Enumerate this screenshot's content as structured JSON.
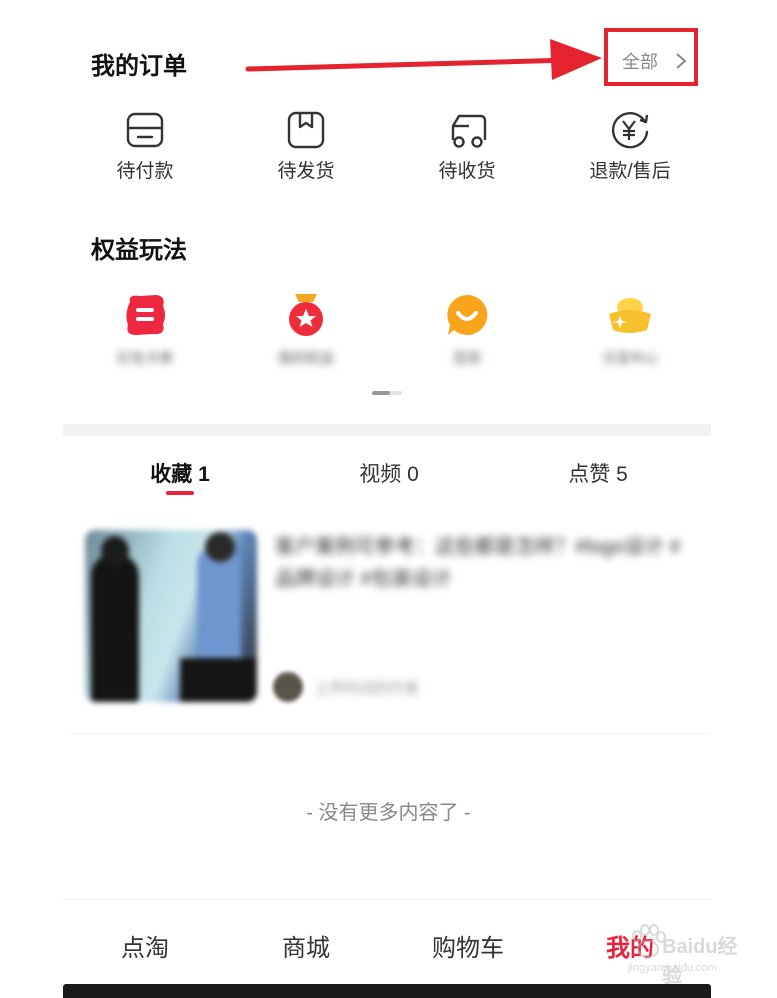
{
  "orders": {
    "title": "我的订单",
    "all_label": "全部",
    "items": [
      {
        "label": "待付款",
        "icon": "wallet-card-icon"
      },
      {
        "label": "待发货",
        "icon": "package-box-icon"
      },
      {
        "label": "待收货",
        "icon": "delivery-truck-icon"
      },
      {
        "label": "退款/售后",
        "icon": "yen-refund-icon"
      }
    ]
  },
  "perks": {
    "title": "权益玩法",
    "items": [
      {
        "label": "红包卡券",
        "icon": "red-coupon-icon"
      },
      {
        "label": "我的权益",
        "icon": "medal-icon"
      },
      {
        "label": "签到",
        "icon": "smile-bubble-icon"
      },
      {
        "label": "元宝中心",
        "icon": "gold-ingot-icon"
      }
    ]
  },
  "tabs": [
    {
      "label": "收藏 1",
      "active": true
    },
    {
      "label": "视频 0",
      "active": false
    },
    {
      "label": "点赞 5",
      "active": false
    }
  ],
  "feed_item": {
    "title": "客户案例可参考：这些都是怎样？#logo设计 #品牌设计 #包装设计",
    "author": "上传时间的作者"
  },
  "end_text": "- 没有更多内容了 -",
  "bottom_nav": [
    {
      "label": "点淘",
      "active": false
    },
    {
      "label": "商城",
      "active": false
    },
    {
      "label": "购物车",
      "active": false
    },
    {
      "label": "我的",
      "active": true
    }
  ],
  "watermark": {
    "text": "Baidu经验",
    "url_text": "jingyan.baidu.com"
  },
  "colors": {
    "accent": "#e8233c",
    "annotation": "#e5232e",
    "divider": "#f2f2f2"
  }
}
